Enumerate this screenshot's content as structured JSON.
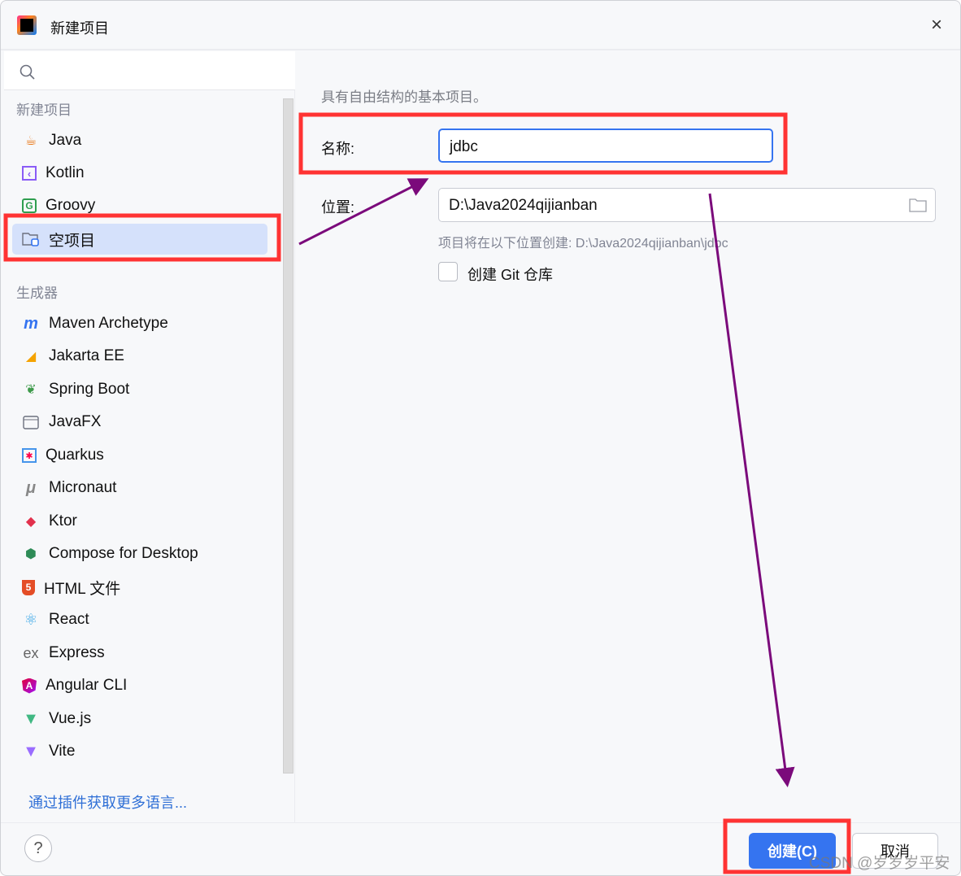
{
  "window": {
    "title": "新建项目",
    "close_icon": "×"
  },
  "sidebar": {
    "section_new": "新建项目",
    "items_new": [
      {
        "label": "Java",
        "icon": "java-cup"
      },
      {
        "label": "Kotlin",
        "icon": "kotlin"
      },
      {
        "label": "Groovy",
        "icon": "groovy"
      },
      {
        "label": "空项目",
        "icon": "empty-project-folder"
      }
    ],
    "section_gen": "生成器",
    "items_gen": [
      {
        "label": "Maven Archetype",
        "icon": "m"
      },
      {
        "label": "Jakarta EE",
        "icon": "jakarta"
      },
      {
        "label": "Spring Boot",
        "icon": "spring"
      },
      {
        "label": "JavaFX",
        "icon": "window"
      },
      {
        "label": "Quarkus",
        "icon": "quarkus"
      },
      {
        "label": "Micronaut",
        "icon": "μ"
      },
      {
        "label": "Ktor",
        "icon": "ktor"
      },
      {
        "label": "Compose for Desktop",
        "icon": "compose"
      },
      {
        "label": "HTML 文件",
        "icon": "html5"
      },
      {
        "label": "React",
        "icon": "react"
      },
      {
        "label": "Express",
        "icon": "ex"
      },
      {
        "label": "Angular CLI",
        "icon": "angular"
      },
      {
        "label": "Vue.js",
        "icon": "vue"
      },
      {
        "label": "Vite",
        "icon": "vite"
      }
    ],
    "more_link": "通过插件获取更多语言..."
  },
  "form": {
    "description": "具有自由结构的基本项目。",
    "name_label": "名称:",
    "name_value": "jdbc",
    "location_label": "位置:",
    "location_value": "D:\\Java2024qijianban",
    "hint": "项目将在以下位置创建: D:\\Java2024qijianban\\jdbc",
    "git_label": "创建 Git 仓库",
    "git_checked": false
  },
  "footer": {
    "help": "?",
    "create": "创建(C)",
    "cancel": "取消"
  },
  "watermark": "CSDN @岁岁岁平安",
  "colors": {
    "accent": "#3574f0",
    "selection": "#d5e1fb",
    "annotation_red": "#ff3333",
    "annotation_arrow": "#7b0a7b"
  }
}
